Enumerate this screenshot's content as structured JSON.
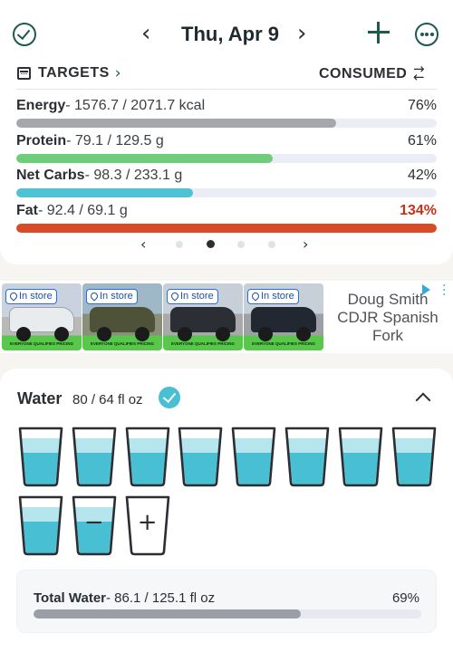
{
  "header": {
    "date": "Thu, Apr 9",
    "prev_glyph": "‹",
    "next_glyph": "›"
  },
  "targets": {
    "title": "TARGETS",
    "chevron": "›",
    "consumed_label": "CONSUMED",
    "nutrients": [
      {
        "name": "Energy",
        "value": "- 1576.7 / 2071.7 kcal",
        "percent": "76%",
        "progress": 0.76,
        "color": "#a5a7ad",
        "over": false
      },
      {
        "name": "Protein",
        "value": "- 79.1 / 129.5 g",
        "percent": "61%",
        "progress": 0.61,
        "color": "#6fcc7a",
        "over": false
      },
      {
        "name": "Net Carbs",
        "value": "- 98.3 / 233.1 g",
        "percent": "42%",
        "progress": 0.42,
        "color": "#4fc2d4",
        "over": false
      },
      {
        "name": "Fat",
        "value": "- 92.4 / 69.1 g",
        "percent": "134%",
        "progress": 1.0,
        "color": "#d94a27",
        "over": true
      }
    ],
    "pager": {
      "prev": "‹",
      "next": "›",
      "pages": 4,
      "active": 1
    }
  },
  "ad": {
    "tags": [
      "In store",
      "In store",
      "In store",
      "In store"
    ],
    "sub_text": "EVERYONE QUALIFIES PRICING",
    "advertiser": "Doug Smith CDJR Spanish Fork"
  },
  "water": {
    "title": "Water",
    "amount": "80 / 64 fl oz",
    "cups_filled": 10,
    "minus_symbol": "−",
    "plus_symbol": "+",
    "total_label": "Total Water",
    "total_value": "- 86.1 / 125.1 fl oz",
    "total_percent": "69%",
    "total_progress": 0.69
  },
  "colors": {
    "accent": "#1e5a4e",
    "water": "#48bfd3",
    "over": "#c4321a"
  }
}
